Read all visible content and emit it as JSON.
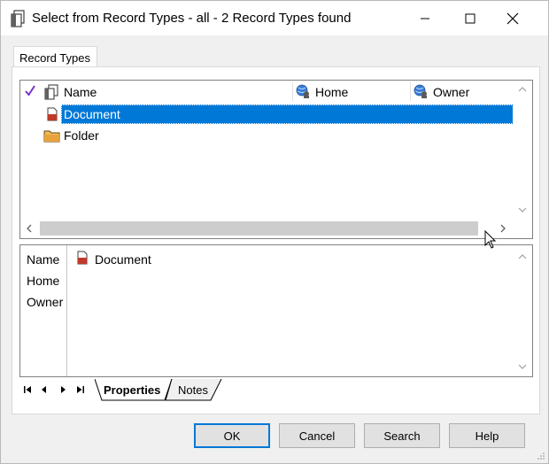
{
  "window": {
    "title": "Select from Record Types - all - 2 Record Types found"
  },
  "tab": {
    "label": "Record Types"
  },
  "grid": {
    "columns": [
      {
        "name": "Name",
        "icon": "record-type-icon"
      },
      {
        "name": "Home",
        "icon": "globe-users-icon"
      },
      {
        "name": "Owner",
        "icon": "globe-users-icon"
      }
    ],
    "rows": [
      {
        "name": "Document",
        "icon": "document-icon",
        "selected": true
      },
      {
        "name": "Folder",
        "icon": "folder-icon",
        "selected": false
      }
    ],
    "check_icon": "checkmark-icon"
  },
  "properties": {
    "labels": [
      "Name",
      "Home",
      "Owner"
    ],
    "name_value": "Document"
  },
  "bottom_tabs": {
    "properties": "Properties",
    "notes": "Notes"
  },
  "buttons": {
    "ok": "OK",
    "cancel": "Cancel",
    "search": "Search",
    "help": "Help"
  },
  "colors": {
    "selection": "#0078d7",
    "window_bg": "#f0f0f0",
    "check": "#7a32c8",
    "document_red": "#c0392b",
    "folder_orange": "#e8a33c"
  }
}
